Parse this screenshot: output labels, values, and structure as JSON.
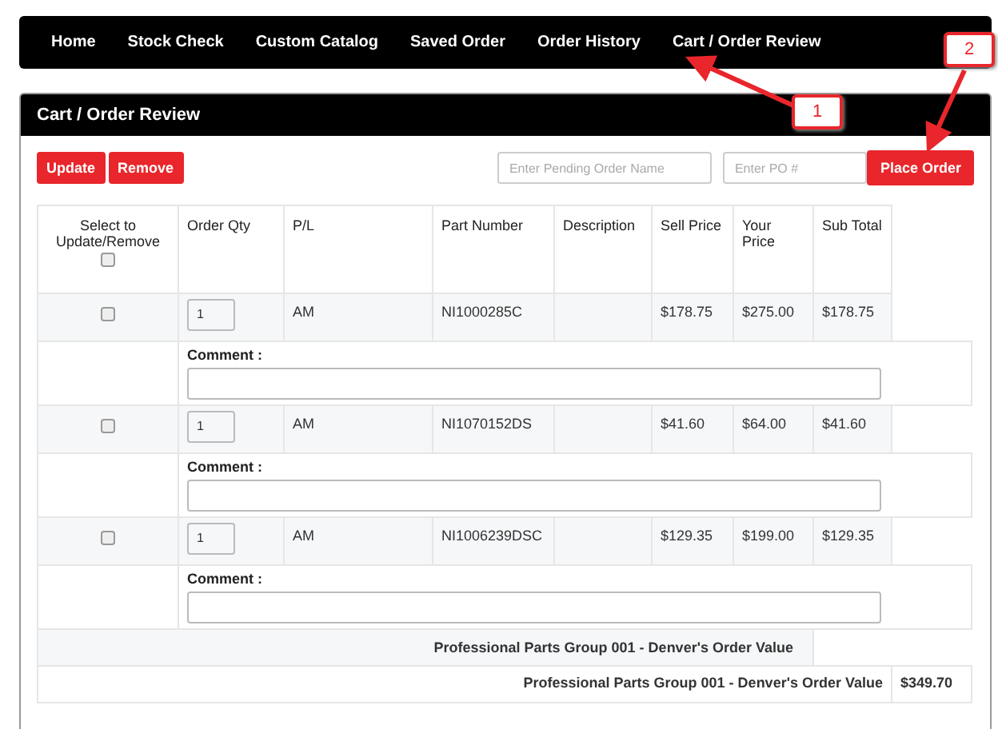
{
  "nav": [
    {
      "label": "Home"
    },
    {
      "label": "Stock Check"
    },
    {
      "label": "Custom Catalog"
    },
    {
      "label": "Saved Order"
    },
    {
      "label": "Order History"
    },
    {
      "label": "Cart / Order Review"
    }
  ],
  "panel": {
    "title": "Cart / Order Review"
  },
  "actions": {
    "buttons": [
      "Update",
      "Remove"
    ],
    "pending_name": {
      "placeholder": "Enter Pending Order Name"
    },
    "po": {
      "placeholder": "Enter PO #"
    },
    "place_order": "Place Order"
  },
  "table": {
    "columns": [
      "Select to Update/Remove",
      "Order Qty",
      "P/L",
      "Part Number",
      "Description",
      "Sell Price",
      "Your Price",
      "Sub Total"
    ],
    "select_all": {
      "checked": false
    },
    "rows": [
      {
        "checked": false,
        "qty": "1",
        "pl": "AM",
        "part_number": "NI1000285C",
        "sell_price": "$178.75",
        "your_price": "$275.00",
        "sub_total": "$178.75",
        "comment_label": "Comment :"
      },
      {
        "checked": false,
        "qty": "1",
        "pl": "AM",
        "part_number": "NI1070152DS",
        "sell_price": "$41.60",
        "your_price": "$64.00",
        "sub_total": "$41.60",
        "comment_label": "Comment :"
      },
      {
        "checked": false,
        "qty": "1",
        "pl": "AM",
        "part_number": "NI1006239DSC",
        "sell_price": "$129.35",
        "your_price": "$199.00",
        "sub_total": "$129.35",
        "comment_label": "Comment :"
      }
    ],
    "group_label": "Professional Parts Group 001 - Denver's Order Value",
    "total": {
      "label": "Professional Parts Group 001 - Denver's Order Value",
      "value": "$349.70"
    }
  },
  "callouts": [
    {
      "label": "1"
    },
    {
      "label": "2"
    }
  ]
}
